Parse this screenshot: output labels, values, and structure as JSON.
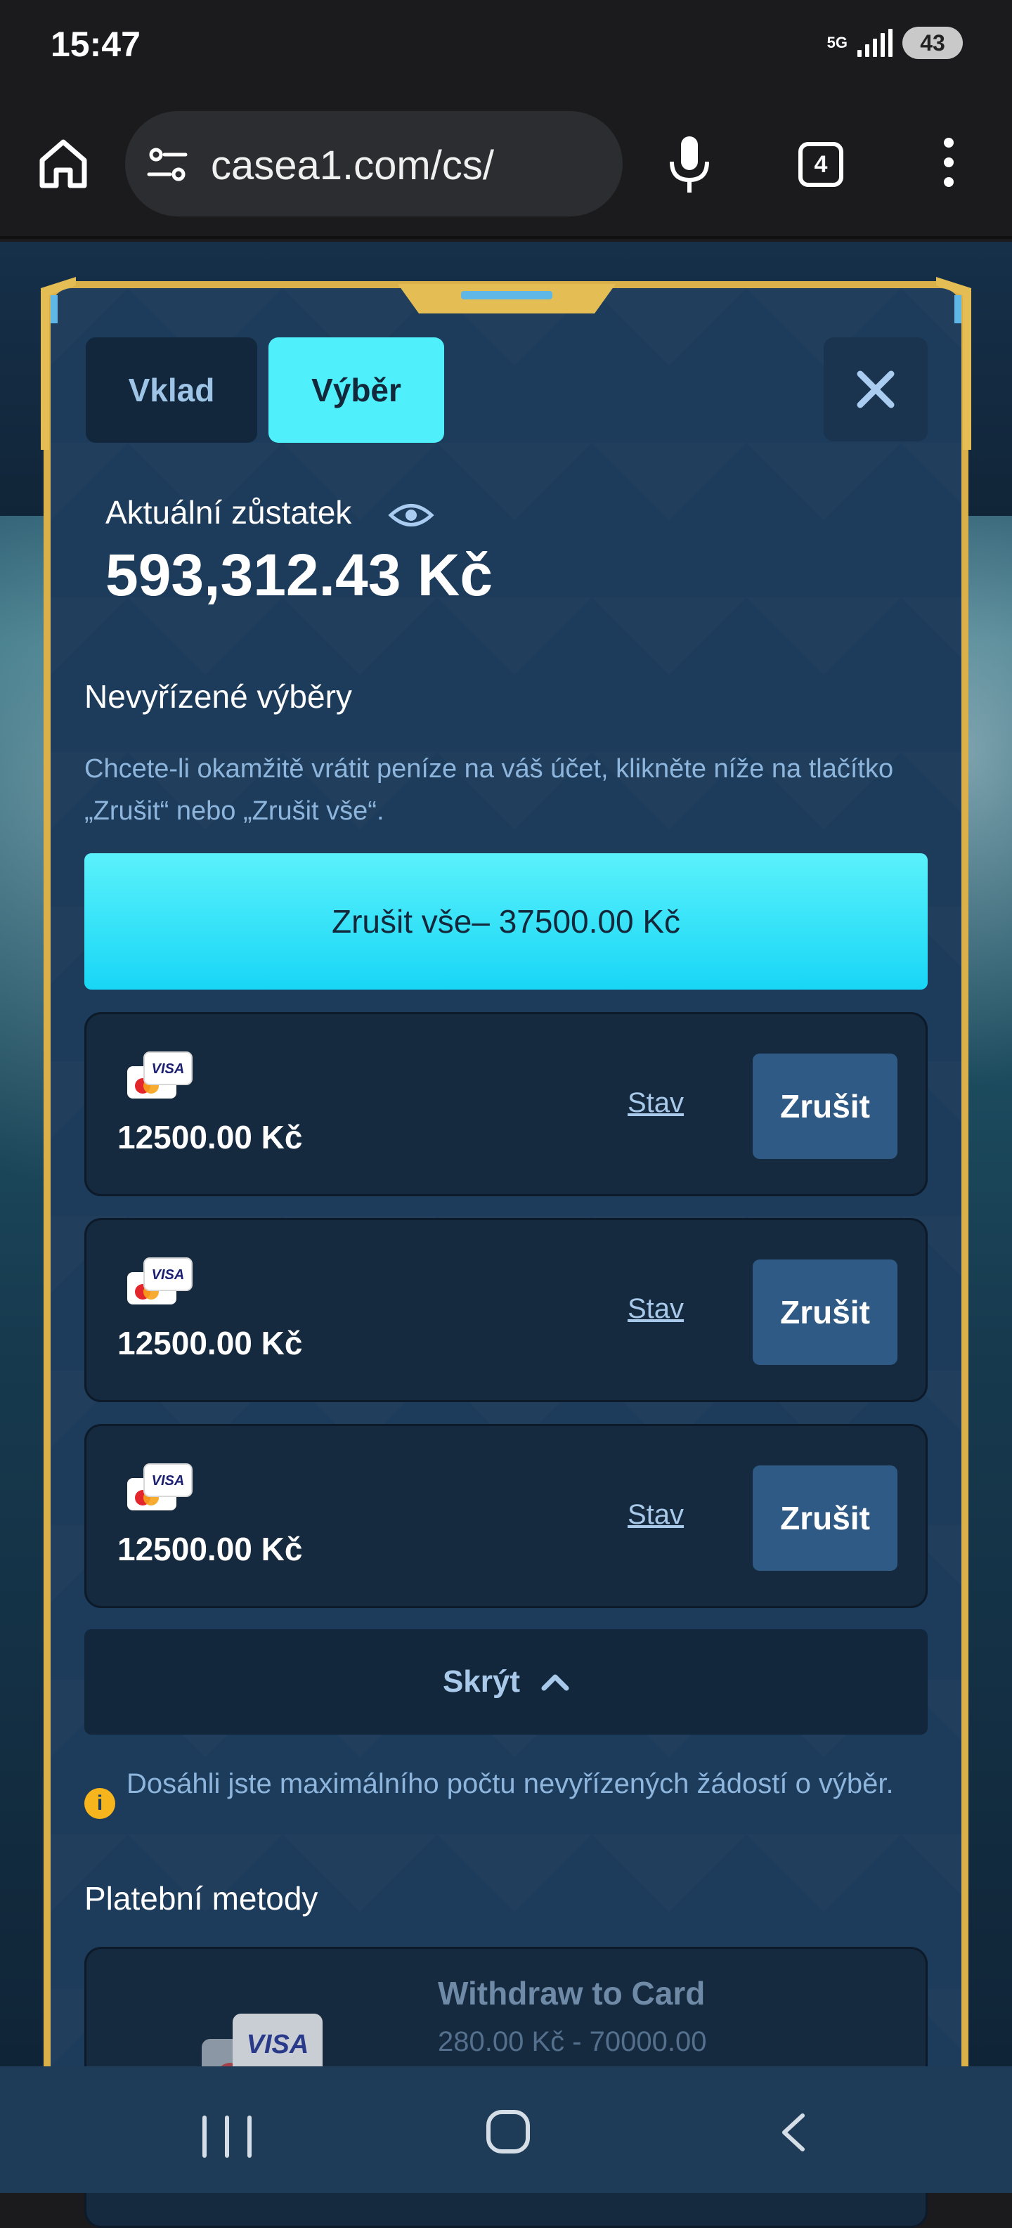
{
  "status_bar": {
    "time": "15:47",
    "network": "5G",
    "battery": "43"
  },
  "browser": {
    "url": "casea1.com/cs/",
    "tab_count": "4"
  },
  "modal": {
    "tabs": [
      {
        "label": "Vklad",
        "active": false
      },
      {
        "label": "Výběr",
        "active": true
      }
    ],
    "balance": {
      "label": "Aktuální zůstatek",
      "value": "593,312.43 Kč"
    },
    "pending": {
      "title": "Nevyřízené výběry",
      "description": "Chcete-li okamžitě vrátit peníze na váš účet, klikněte níže na tlačítko „Zrušit“ nebo „Zrušit vše“.",
      "cancel_all_label": "Zrušit vše– 37500.00 Kč",
      "items": [
        {
          "amount": "12500.00 Kč",
          "status_label": "Stav",
          "cancel_label": "Zrušit",
          "card_brand": "VISA"
        },
        {
          "amount": "12500.00 Kč",
          "status_label": "Stav",
          "cancel_label": "Zrušit",
          "card_brand": "VISA"
        },
        {
          "amount": "12500.00 Kč",
          "status_label": "Stav",
          "cancel_label": "Zrušit",
          "card_brand": "VISA"
        }
      ],
      "hide_label": "Skrýt",
      "warning": "Dosáhli jste maximálního počtu nevyřízených žádostí o výběr."
    },
    "payment_methods": {
      "title": "Platební metody",
      "items": [
        {
          "name": "Withdraw to Card",
          "range": "280.00 Kč - 70000.00",
          "card_brand": "VISA"
        }
      ]
    }
  },
  "colors": {
    "accent": "#4ff0fb",
    "panel": "#1d3b5a",
    "gold": "#d9b04a",
    "warning": "#f6b51c"
  }
}
